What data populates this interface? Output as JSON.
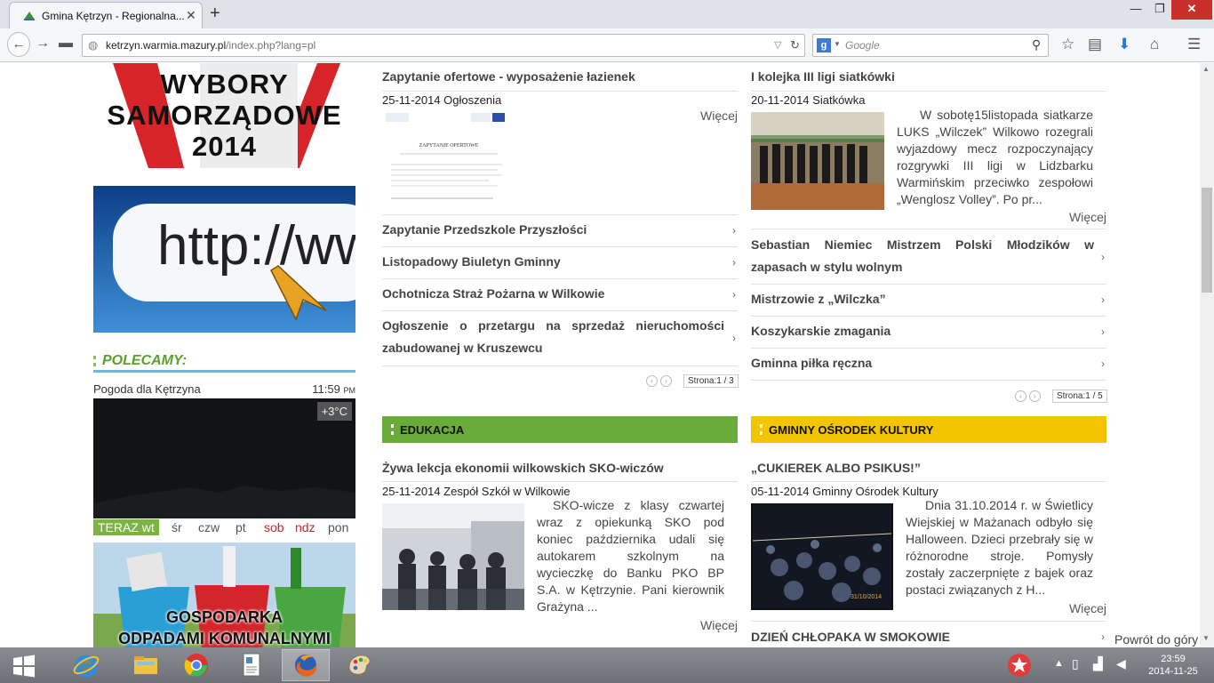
{
  "browser": {
    "tab_title": "Gmina Kętrzyn - Regionalna...",
    "tab_close": "✕",
    "new_tab": "+",
    "window_min": "—",
    "window_max": "❐",
    "window_close": "✕",
    "url_host": "ketrzyn.warmia.mazury.pl",
    "url_path": "/index.php?lang=pl",
    "search_placeholder": "Google",
    "icons": [
      "back-icon",
      "forward-icon",
      "tab-groups-icon",
      "globe-icon",
      "reload-icon",
      "google-icon",
      "search-icon",
      "star-icon",
      "bookmarks-icon",
      "download-icon",
      "home-icon",
      "menu-icon"
    ]
  },
  "sidebar": {
    "wybory_line1": "WYBORY",
    "wybory_line2": "SAMORZĄDOWE",
    "wybory_line3": "2014",
    "http_text": "http://www.",
    "polecamy": "POLECAMY:",
    "weather_title": "Pogoda dla Kętrzyna",
    "weather_time": "11:59",
    "weather_ampm": "PM",
    "temperature": "+3°C",
    "days": {
      "now": "TERAZ wt",
      "d1": "śr",
      "d2": "czw",
      "d3": "pt",
      "d4": "sob",
      "d5": "ndz",
      "d6": "pon"
    },
    "odpady_line1": "GOSPODARKA",
    "odpady_line2": "ODPADAMI KOMUNALNYMI"
  },
  "news_left": {
    "feature_title": "Zapytanie ofertowe - wyposażenie łazienek",
    "feature_date": "25-11-2014",
    "feature_category": "Ogłoszenia",
    "more": "Więcej",
    "doc_heading": "ZAPYTANIE OFERTOWE",
    "items": [
      "Zapytanie Przedszkole Przyszłości",
      "Listopadowy Biuletyn Gminny",
      "Ochotnicza Straż Pożarna w Wilkowie",
      "Ogłoszenie o przetargu na sprzedaż nieruchomości zabudowanej w Kruszewcu"
    ],
    "pager_label": "Strona:",
    "pager_value": "1 / 3"
  },
  "news_right": {
    "feature_title": "I kolejka III ligi siatkówki",
    "feature_date": "20-11-2014",
    "feature_category": "Siatkówka",
    "feature_body": "W sobotę15listopada siatkarze LUKS „Wilczek” Wilkowo rozegrali wyjazdowy mecz rozpoczynający rozgrywki III ligi w Lidzbarku Warmińskim przeciwko zespołowi „Wenglosz Volley”. Po pr...",
    "more": "Więcej",
    "items": [
      "Sebastian Niemiec Mistrzem Polski Młodzików w zapasach w stylu wolnym",
      "Mistrzowie z „Wilczka”",
      "Koszykarskie zmagania",
      "Gminna piłka ręczna"
    ],
    "pager_label": "Strona:",
    "pager_value": "1 / 5"
  },
  "edukacja": {
    "header": "EDUKACJA",
    "title": "Żywa lekcja ekonomii wilkowskich SKO-wiczów",
    "date": "25-11-2014",
    "category": "Zespół Szkół w Wilkowie",
    "body": "SKO-wicze z klasy czwartej wraz z opiekunką SKO pod koniec października udali się autokarem szkolnym na wycieczkę do Banku PKO BP S.A. w Kętrzynie. Pani kierownik Grażyna ...",
    "more": "Więcej"
  },
  "kultura": {
    "header": "GMINNY OŚRODEK KULTURY",
    "title": "„CUKIEREK ALBO PSIKUS!”",
    "date": "05-11-2014",
    "category": "Gminny Ośrodek Kultury",
    "body": "Dnia 31.10.2014 r. w Świetlicy Wiejskiej w Mażanach odbyło się Halloween. Dzieci przebrały się w różnorodne stroje. Pomysły zostały zaczerpnięte z bajek oraz postaci związanych z H...",
    "more": "Więcej",
    "photo_stamp": "31/10/2014",
    "next_title": "DZIEŃ CHŁOPAKA W SMOKOWIE"
  },
  "back_to_top": "Powrót do góry",
  "taskbar": {
    "time": "23:59",
    "date": "2014-11-25",
    "apps": [
      "windows-start",
      "internet-explorer",
      "file-explorer",
      "chrome",
      "documents",
      "firefox",
      "paint"
    ]
  },
  "colors": {
    "edukacja_bar": "#6aac3a",
    "kultura_bar": "#f2c500",
    "polecamy_green": "#5aa02c",
    "polecamy_line": "#6fb7d8",
    "weekend_red": "#c0282d",
    "close_red": "#c9302c"
  }
}
